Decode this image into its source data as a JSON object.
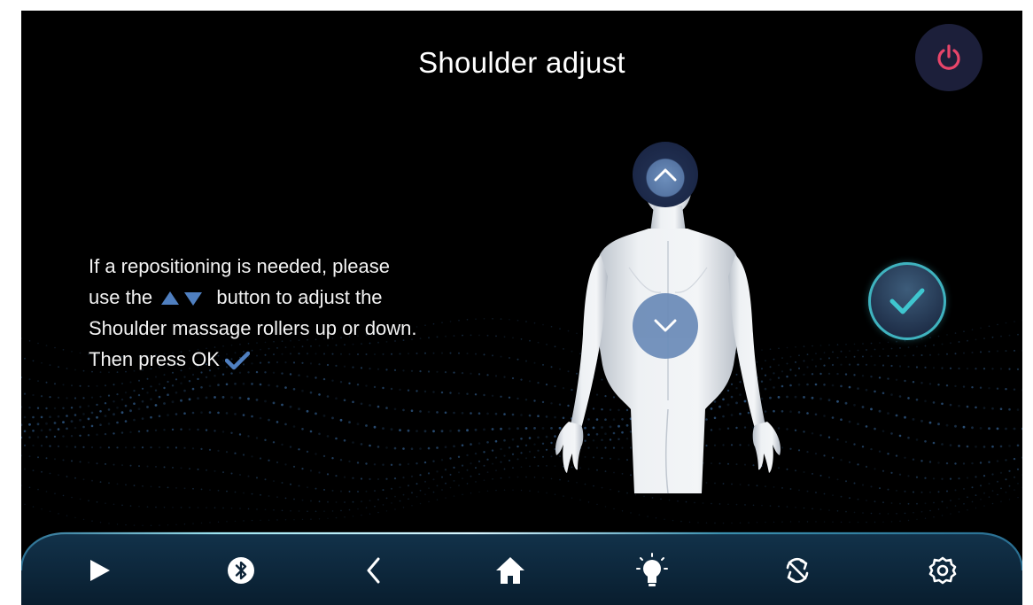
{
  "header": {
    "title": "Shoulder adjust",
    "power_icon": "power-icon"
  },
  "instructions": {
    "line1": " If a repositioning is needed, please",
    "line2_prefix": "use the ",
    "line2_suffix": " button to adjust the",
    "line3": "Shoulder massage rollers up or down.",
    "line4": "Then press OK "
  },
  "controls": {
    "up_icon": "chevron-up-icon",
    "down_icon": "chevron-down-icon",
    "ok_icon": "checkmark-icon"
  },
  "nav": {
    "items": [
      {
        "icon": "play-icon"
      },
      {
        "icon": "bluetooth-icon"
      },
      {
        "icon": "back-icon"
      },
      {
        "icon": "home-icon"
      },
      {
        "icon": "light-bulb-icon"
      },
      {
        "icon": "sync-icon"
      },
      {
        "icon": "settings-icon"
      }
    ]
  },
  "colors": {
    "background": "#000000",
    "accent_blue": "#4f7fc0",
    "accent_teal": "#3fb3bf",
    "power_red": "#e8456a",
    "button_fill": "#6e8db9"
  }
}
